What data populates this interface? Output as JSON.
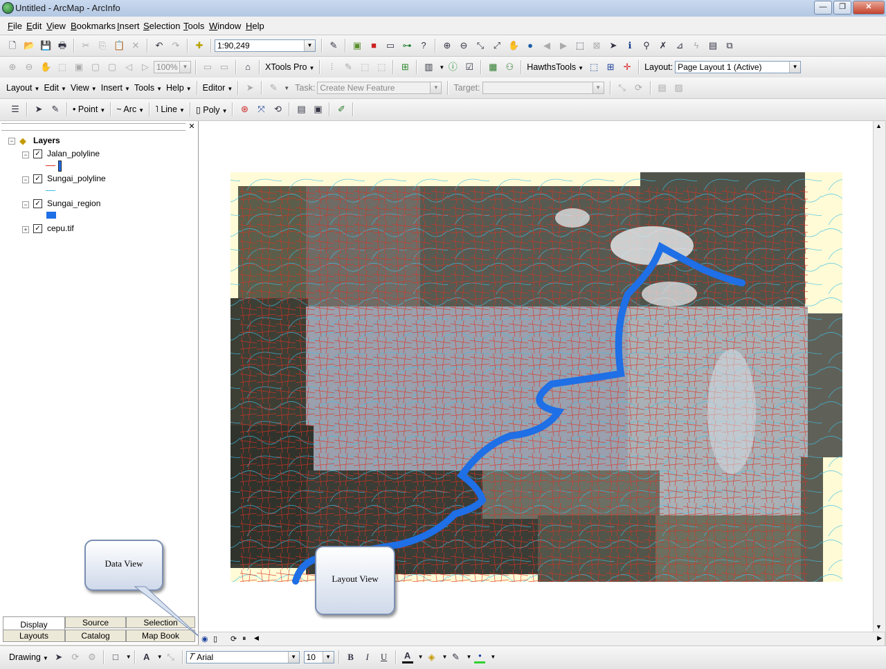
{
  "window": {
    "title": "Untitled - ArcMap - ArcInfo",
    "btn_min": "—",
    "btn_max": "❐",
    "btn_close": "✕"
  },
  "menu": [
    "File",
    "Edit",
    "View",
    "Bookmarks",
    "Insert",
    "Selection",
    "Tools",
    "Window",
    "Help"
  ],
  "standard_toolbar": {
    "scale": "1:90,249"
  },
  "layout_toolbar": {
    "zoom": "100%",
    "xtools": "XTools Pro",
    "hawths": "HawthsTools",
    "layout_label": "Layout:",
    "layout_value": "Page Layout 1 (Active)"
  },
  "editor_toolbar": {
    "menus": [
      "Layout",
      "Edit",
      "View",
      "Insert",
      "Tools",
      "Help"
    ],
    "editor": "Editor",
    "task_label": "Task:",
    "task_value": "Create New Feature",
    "target_label": "Target:"
  },
  "draw_toolbar": {
    "point": "Point",
    "arc": "Arc",
    "line": "Line",
    "poly": "Poly"
  },
  "toc": {
    "root": "Layers",
    "layers": [
      {
        "name": "Jalan_polyline",
        "checked": true
      },
      {
        "name": "Sungai_polyline",
        "checked": true
      },
      {
        "name": "Sungai_region",
        "checked": true
      },
      {
        "name": "cepu.tif",
        "checked": true
      }
    ],
    "tabs_row1": [
      "Display",
      "Source",
      "Selection"
    ],
    "tabs_row2": [
      "Layouts",
      "Catalog",
      "Map Book"
    ]
  },
  "callouts": {
    "data_view": "Data View",
    "layout_view": "Layout View"
  },
  "drawing_toolbar": {
    "drawing": "Drawing",
    "font": "Arial",
    "size": "10",
    "bold": "B",
    "italic": "I",
    "underline": "U",
    "font_color": "A"
  },
  "colors": {
    "river_region": "#1f6fe6",
    "road": "#e03020",
    "stream": "#3fbfe6",
    "page_margin": "#fffbd6"
  }
}
